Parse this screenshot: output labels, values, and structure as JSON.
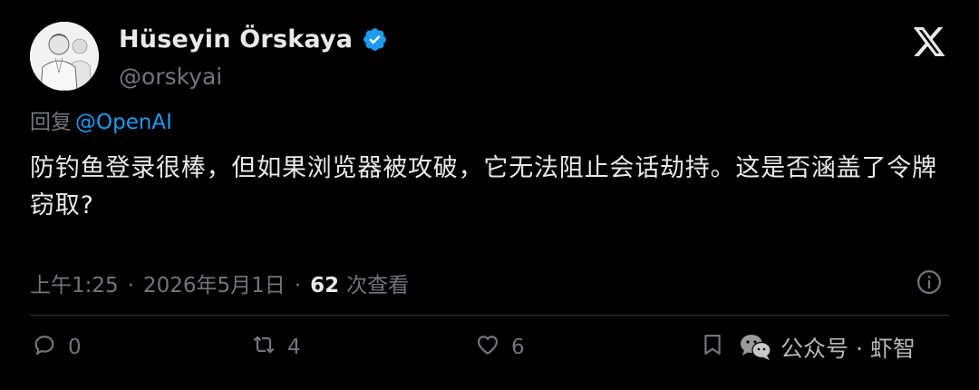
{
  "author": {
    "display_name": "Hüseyin Örskaya",
    "handle": "@orskyai"
  },
  "reply": {
    "prefix": "回复",
    "mention": "@OpenAI"
  },
  "tweet": {
    "text": "防钓鱼登录很棒，但如果浏览器被攻破，它无法阻止会话劫持。这是否涵盖了令牌窃取?"
  },
  "meta": {
    "time": "上午1:25",
    "separator": "·",
    "date": "2026年5月1日",
    "views_count": "62",
    "views_label": "次查看"
  },
  "actions": {
    "replies": "0",
    "retweets": "4",
    "likes": "6"
  },
  "watermark": {
    "text": "公众号 · 虾智"
  },
  "colors": {
    "background": "#000000",
    "text": "#e7e9ea",
    "secondary": "#71767b",
    "accent": "#1d9bf0"
  },
  "icons": [
    "verified-badge-icon",
    "x-logo-icon",
    "info-icon",
    "reply-icon",
    "retweet-icon",
    "like-icon",
    "bookmark-icon",
    "wechat-icon"
  ]
}
